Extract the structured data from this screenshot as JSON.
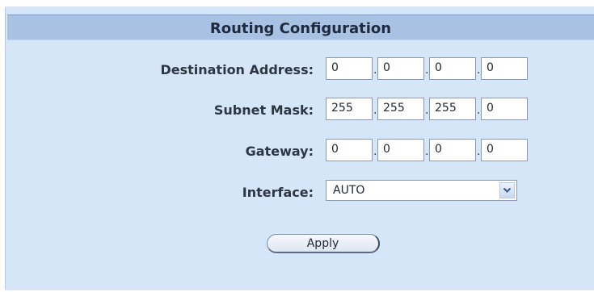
{
  "title": "Routing Configuration",
  "fields": {
    "destination": {
      "label": "Destination Address:",
      "octets": [
        "0",
        "0",
        "0",
        "0"
      ]
    },
    "subnet": {
      "label": "Subnet Mask:",
      "octets": [
        "255",
        "255",
        "255",
        "0"
      ]
    },
    "gateway": {
      "label": "Gateway:",
      "octets": [
        "0",
        "0",
        "0",
        "0"
      ]
    },
    "interface": {
      "label": "Interface:",
      "value": "AUTO"
    }
  },
  "separator": ".",
  "apply_label": "Apply",
  "colors": {
    "panel_bg": "#d6e6f9",
    "title_bg": "#a9c2e4",
    "label_text": "#2c3644"
  },
  "icons": {
    "dropdown": "chevron-down-icon"
  }
}
